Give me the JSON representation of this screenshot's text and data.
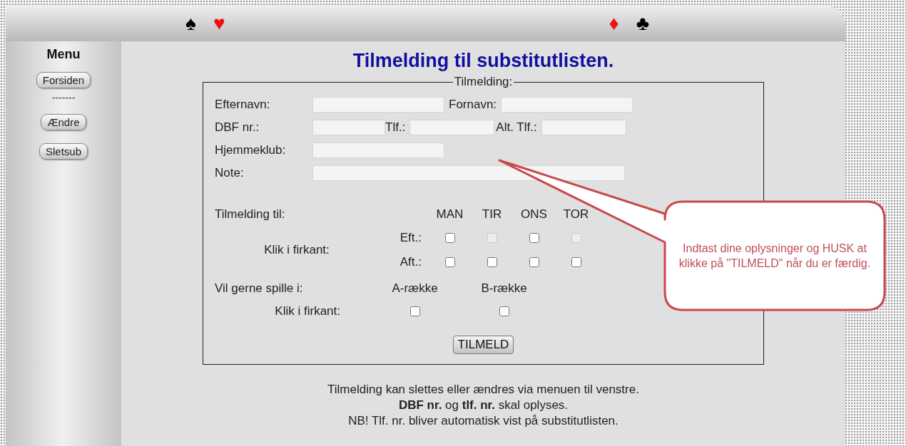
{
  "header": {
    "suits": [
      {
        "symbol": "♠",
        "color": "#000000"
      },
      {
        "symbol": "♥",
        "color": "#ee1111"
      },
      {
        "symbol": "♦",
        "color": "#ee1111"
      },
      {
        "symbol": "♣",
        "color": "#000000"
      }
    ]
  },
  "sidebar": {
    "title": "Menu",
    "items": [
      {
        "kind": "button",
        "label": "Forsiden"
      },
      {
        "kind": "separator",
        "label": "-------"
      },
      {
        "kind": "button",
        "label": "Ændre"
      },
      {
        "kind": "button",
        "label": "Sletsub"
      }
    ]
  },
  "title": "Tilmelding til substitutlisten.",
  "form": {
    "legend": "Tilmelding:",
    "field_rows": [
      [
        {
          "label": "Efternavn:"
        },
        {
          "label": "Fornavn:"
        }
      ],
      [
        {
          "label": "DBF nr.:"
        },
        {
          "label": "Tlf.:"
        },
        {
          "label": "Alt. Tlf.:"
        }
      ],
      [
        {
          "label": "Hjemmeklub:"
        }
      ],
      [
        {
          "label": "Note:"
        }
      ]
    ],
    "schedule": {
      "label": "Tilmelding til:",
      "hint": "Klik i firkant:",
      "days": [
        "MAN",
        "TIR",
        "ONS",
        "TOR"
      ],
      "rows": [
        {
          "label": "Eft.:",
          "boxes": [
            {
              "checked": false,
              "disabled": false
            },
            {
              "checked": false,
              "disabled": true
            },
            {
              "checked": false,
              "disabled": false
            },
            {
              "checked": false,
              "disabled": true
            }
          ]
        },
        {
          "label": "Aft.:",
          "boxes": [
            {
              "checked": false,
              "disabled": false
            },
            {
              "checked": false,
              "disabled": false
            },
            {
              "checked": false,
              "disabled": false
            },
            {
              "checked": false,
              "disabled": false
            }
          ]
        }
      ]
    },
    "rows_pref": {
      "label": "Vil gerne spille i:",
      "hint": "Klik i firkant:",
      "options": [
        {
          "label": "A-række",
          "checked": false
        },
        {
          "label": "B-række",
          "checked": false
        }
      ]
    },
    "submit": "TILMELD"
  },
  "notes": [
    "Tilmelding kan slettes eller ændres via menuen til venstre.",
    "**DBF nr.** og **tlf. nr.** skal oplyses.",
    "NB! Tlf. nr. bliver automatisk vist på substitutlisten."
  ],
  "callout": {
    "text": "Indtast dine oplysninger og HUSK at klikke på \"TILMELD\" når du er færdig."
  }
}
